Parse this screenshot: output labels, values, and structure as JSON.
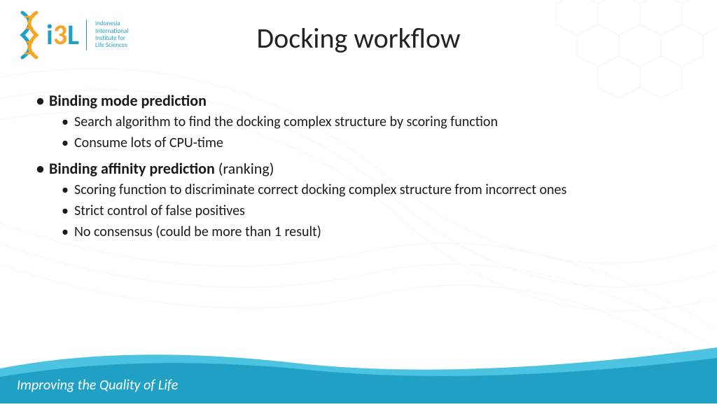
{
  "logo": {
    "name_parts": {
      "i": "i",
      "three": "3",
      "L": "L"
    },
    "subtitle_line1": "Indonesia",
    "subtitle_line2": "International",
    "subtitle_line3": "Institute for",
    "subtitle_line4": "Life Sciences"
  },
  "title": "Docking workflow",
  "sections": [
    {
      "heading": "Binding mode prediction",
      "heading_suffix": "",
      "items": [
        "Search algorithm to find the docking complex structure by scoring function",
        "Consume lots of CPU-time"
      ]
    },
    {
      "heading": "Binding affinity prediction",
      "heading_suffix": " (ranking)",
      "items": [
        "Scoring function to discriminate correct docking complex structure from incorrect ones",
        "Strict control of false positives",
        "No consensus (could be more than 1 result)"
      ]
    }
  ],
  "footer": "Improving the Quality of Life",
  "colors": {
    "brand_teal": "#1fa0c4",
    "brand_orange": "#f5a623",
    "wave_dark": "#0a92b8",
    "wave_light": "#4cc3e0"
  }
}
